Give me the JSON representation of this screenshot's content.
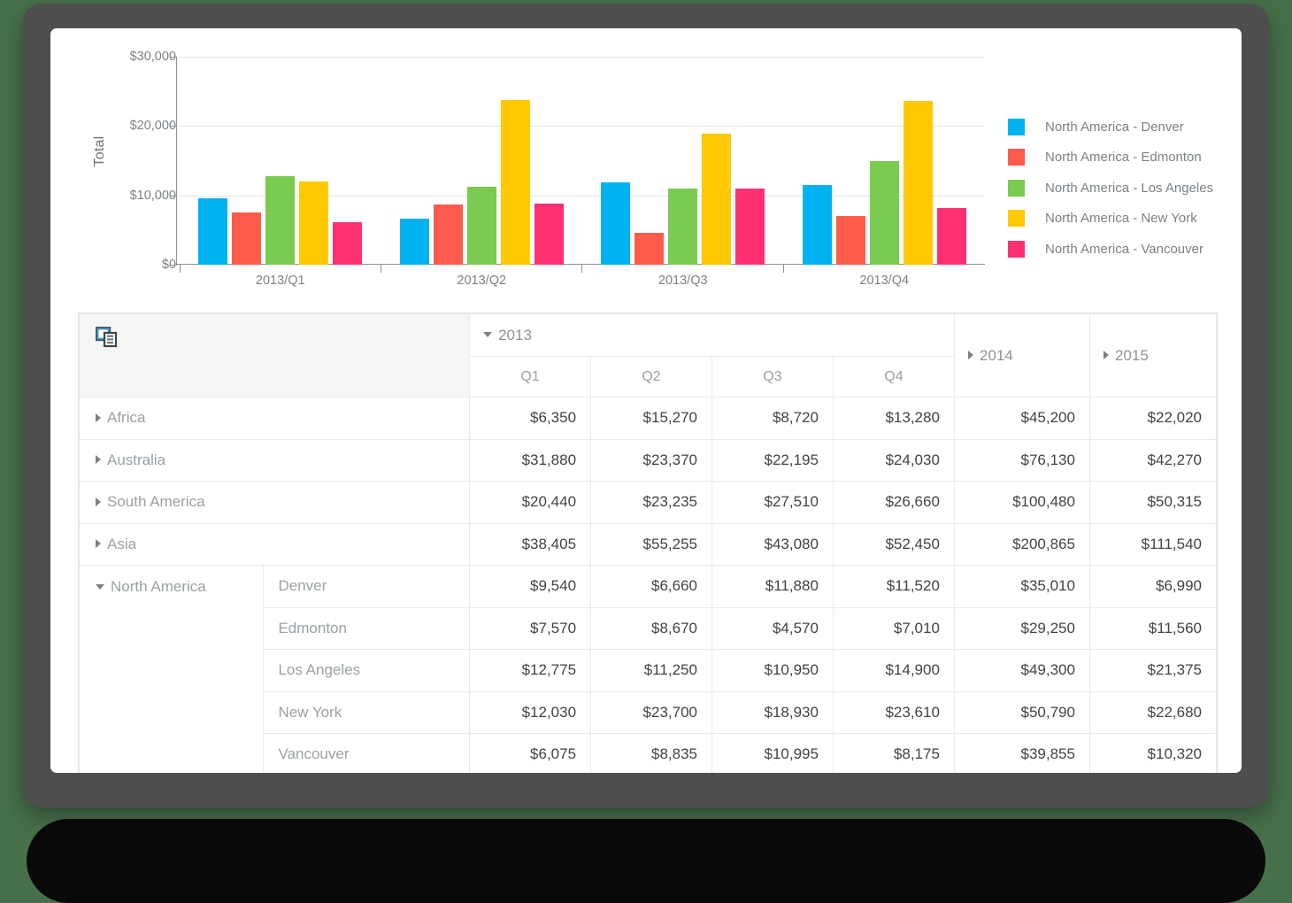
{
  "chart_data": {
    "type": "bar",
    "title": "",
    "xlabel": "",
    "ylabel": "Total",
    "ylim": [
      0,
      30000
    ],
    "ytick_labels": [
      "$0",
      "$10,000",
      "$20,000",
      "$30,000"
    ],
    "ytick_values": [
      0,
      10000,
      20000,
      30000
    ],
    "grid": true,
    "legend_position": "right",
    "categories": [
      "2013/Q1",
      "2013/Q2",
      "2013/Q3",
      "2013/Q4"
    ],
    "series": [
      {
        "name": "North America - Denver",
        "color": "#00b2f0",
        "values": [
          9540,
          6660,
          11880,
          11520
        ]
      },
      {
        "name": "North America - Edmonton",
        "color": "#ff5b4d",
        "values": [
          7570,
          8670,
          4570,
          7010
        ]
      },
      {
        "name": "North America - Los Angeles",
        "color": "#79cc4f",
        "values": [
          12775,
          11250,
          10950,
          14900
        ]
      },
      {
        "name": "North America - New York",
        "color": "#ffc800",
        "values": [
          12030,
          23700,
          18930,
          23610
        ]
      },
      {
        "name": "North America - Vancouver",
        "color": "#ff3072",
        "values": [
          6075,
          8835,
          10995,
          8175
        ]
      }
    ]
  },
  "grid": {
    "corner_icon": "pivot-fields-icon",
    "year_headers": [
      {
        "label": "2013",
        "expanded": true,
        "marker": "down"
      },
      {
        "label": "2014",
        "expanded": false,
        "marker": "right"
      },
      {
        "label": "2015",
        "expanded": false,
        "marker": "right"
      }
    ],
    "quarter_headers": [
      "Q1",
      "Q2",
      "Q3",
      "Q4"
    ],
    "rows": [
      {
        "region": "Africa",
        "city": "",
        "expanded": false,
        "marker": "right",
        "values": [
          "$6,350",
          "$15,270",
          "$8,720",
          "$13,280",
          "$45,200",
          "$22,020"
        ]
      },
      {
        "region": "Australia",
        "city": "",
        "expanded": false,
        "marker": "right",
        "values": [
          "$31,880",
          "$23,370",
          "$22,195",
          "$24,030",
          "$76,130",
          "$42,270"
        ]
      },
      {
        "region": "South America",
        "city": "",
        "expanded": false,
        "marker": "right",
        "values": [
          "$20,440",
          "$23,235",
          "$27,510",
          "$26,660",
          "$100,480",
          "$50,315"
        ]
      },
      {
        "region": "Asia",
        "city": "",
        "expanded": false,
        "marker": "right",
        "values": [
          "$38,405",
          "$55,255",
          "$43,080",
          "$52,450",
          "$200,865",
          "$111,540"
        ]
      },
      {
        "region": "North America",
        "city": "Denver",
        "expanded": true,
        "marker": "down",
        "values": [
          "$9,540",
          "$6,660",
          "$11,880",
          "$11,520",
          "$35,010",
          "$6,990"
        ]
      },
      {
        "region": "",
        "city": "Edmonton",
        "expanded": null,
        "marker": "",
        "values": [
          "$7,570",
          "$8,670",
          "$4,570",
          "$7,010",
          "$29,250",
          "$11,560"
        ]
      },
      {
        "region": "",
        "city": "Los Angeles",
        "expanded": null,
        "marker": "",
        "values": [
          "$12,775",
          "$11,250",
          "$10,950",
          "$14,900",
          "$49,300",
          "$21,375"
        ]
      },
      {
        "region": "",
        "city": "New York",
        "expanded": null,
        "marker": "",
        "values": [
          "$12,030",
          "$23,700",
          "$18,930",
          "$23,610",
          "$50,790",
          "$22,680"
        ]
      },
      {
        "region": "",
        "city": "Vancouver",
        "expanded": null,
        "marker": "",
        "values": [
          "$6,075",
          "$8,835",
          "$10,995",
          "$8,175",
          "$39,855",
          "$10,320"
        ]
      }
    ]
  },
  "theme": {
    "bezel": "#4e4e4e",
    "background": "#47704a",
    "screen": "#ffffff",
    "grid_line": "#e2e4e6",
    "axis": "#8d9296",
    "text_muted": "#7b8185",
    "text_value": "#3f4447"
  }
}
